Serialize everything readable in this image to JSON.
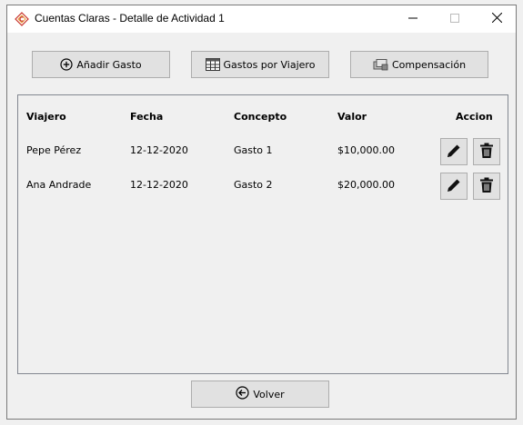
{
  "window": {
    "title": "Cuentas Claras - Detalle de Actividad 1",
    "app_icon": "diamond-logo-icon",
    "controls": [
      "minimize-icon",
      "maximize-icon",
      "close-icon"
    ]
  },
  "toolbar": {
    "add_expense_label": "Añadir Gasto",
    "add_expense_icon": "plus-circle-icon",
    "expenses_by_traveler_label": "Gastos por Viajero",
    "expenses_by_traveler_icon": "table-grid-icon",
    "compensation_label": "Compensación",
    "compensation_icon": "money-cards-icon"
  },
  "table": {
    "columns": {
      "traveler": "Viajero",
      "date": "Fecha",
      "concept": "Concepto",
      "value": "Valor",
      "action": "Accion"
    },
    "rows": [
      {
        "traveler": "Pepe Pérez",
        "date": "12-12-2020",
        "concept": "Gasto 1",
        "value": "$10,000.00"
      },
      {
        "traveler": "Ana Andrade",
        "date": "12-12-2020",
        "concept": "Gasto 2",
        "value": "$20,000.00"
      }
    ],
    "row_actions": [
      "edit-pencil-icon",
      "delete-trash-icon"
    ]
  },
  "footer": {
    "back_label": "Volver",
    "back_icon": "arrow-left-circle-icon"
  },
  "colors": {
    "window_bg": "#f0f0f0",
    "titlebar_bg": "#ffffff",
    "button_bg": "#e1e1e1",
    "button_border": "#adadad",
    "logo_red": "#c8322a"
  }
}
